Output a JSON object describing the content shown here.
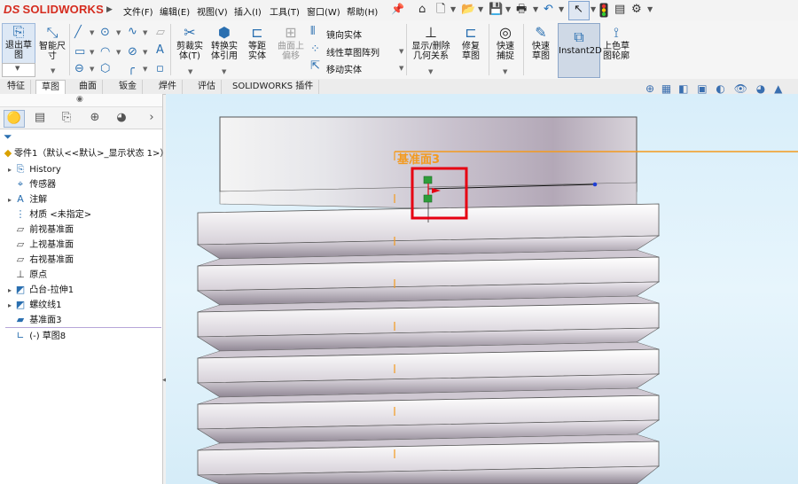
{
  "app": {
    "logo": "SOLIDWORKS",
    "logo_ds": "DS"
  },
  "menu": [
    "文件(F)",
    "编辑(E)",
    "视图(V)",
    "插入(I)",
    "工具(T)",
    "窗口(W)",
    "帮助(H)"
  ],
  "ribbon": {
    "exit_sketch": "退出草图",
    "smart_dim": "智能尺寸",
    "trim": "剪裁实体(T)",
    "convert": "转换实体引用",
    "offset": "等距实体",
    "surface_offset": "曲面上偏移",
    "mirror": "镜向实体",
    "linear_pattern": "线性草图阵列",
    "move": "移动实体",
    "display_relations": "显示/删除几何关系",
    "repair": "修复草图",
    "quick_snap": "快速捕捉",
    "rapid_sketch": "快速草图",
    "instant2d": "Instant2D",
    "shaded_contour": "上色草图轮廓"
  },
  "tabs": [
    "特征",
    "草图",
    "曲面",
    "钣金",
    "焊件",
    "评估",
    "SOLIDWORKS 插件"
  ],
  "active_tab": "草图",
  "tree": {
    "root": "零件1（默认<<默认>_显示状态 1>）",
    "items": [
      {
        "label": "History",
        "icon": "history-icon",
        "expand": true
      },
      {
        "label": "传感器",
        "icon": "sensor-icon",
        "expand": false
      },
      {
        "label": "注解",
        "icon": "annotation-icon",
        "expand": true
      },
      {
        "label": "材质 <未指定>",
        "icon": "material-icon",
        "expand": false
      },
      {
        "label": "前视基准面",
        "icon": "plane-icon",
        "expand": false
      },
      {
        "label": "上视基准面",
        "icon": "plane-icon",
        "expand": false
      },
      {
        "label": "右视基准面",
        "icon": "plane-icon",
        "expand": false
      },
      {
        "label": "原点",
        "icon": "origin-icon",
        "expand": false
      },
      {
        "label": "凸台-拉伸1",
        "icon": "extrude-icon",
        "expand": true
      },
      {
        "label": "螺纹线1",
        "icon": "thread-icon",
        "expand": true
      },
      {
        "label": "基准面3",
        "icon": "plane-icon",
        "expand": false
      },
      {
        "label": "(-) 草图8",
        "icon": "sketch-icon",
        "expand": false
      }
    ]
  },
  "viewport": {
    "plane_label": "基准面3"
  },
  "colors": {
    "plane_orange": "#f39a1e",
    "highlight_red": "#e60012",
    "endpoint_blue": "#1f3fd6",
    "relation_green": "#2e9d3a"
  }
}
